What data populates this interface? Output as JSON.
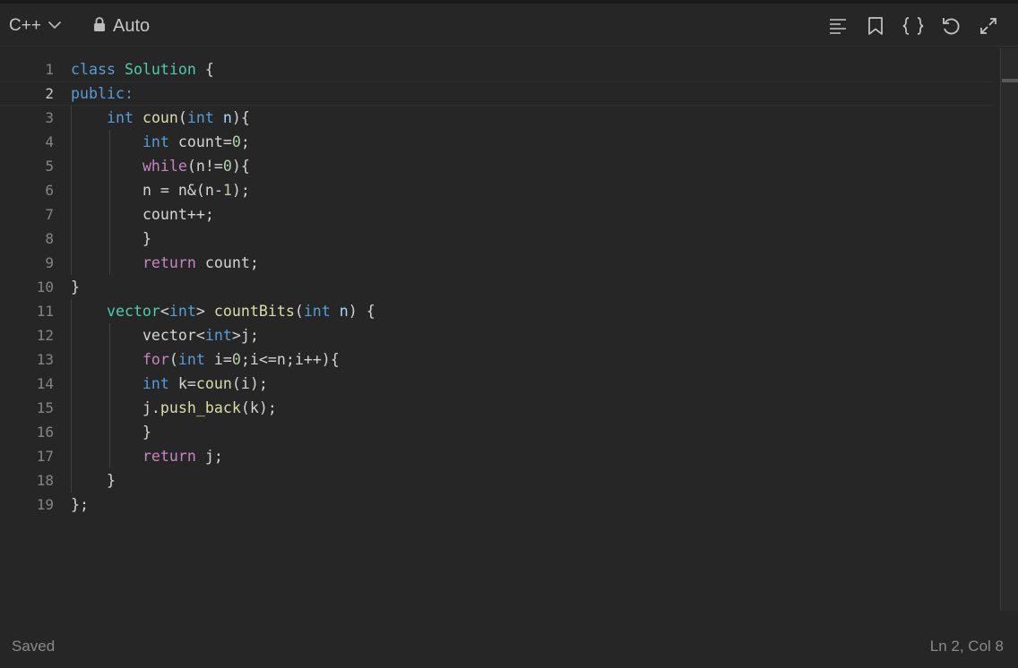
{
  "toolbar": {
    "language": "C++",
    "mode": "Auto",
    "icons": [
      "format-icon",
      "bookmark-icon",
      "braces-icon",
      "undo-icon",
      "expand-icon"
    ]
  },
  "colors": {
    "background": "#262626",
    "keyword": "#569cd6",
    "type_name": "#4ec9b0",
    "function": "#dcdcaa",
    "control": "#c586c0",
    "number": "#b5cea8",
    "variable": "#9cdcfe",
    "plain": "#d4d4d4",
    "line_number": "#858585"
  },
  "editor": {
    "active_line": 2,
    "lines": [
      {
        "n": "1",
        "tokens": [
          {
            "t": "class",
            "c": "keyword"
          },
          {
            "t": " "
          },
          {
            "t": "Solution",
            "c": "type_name"
          },
          {
            "t": " {"
          }
        ]
      },
      {
        "n": "2",
        "tokens": [
          {
            "t": "public:",
            "c": "keyword"
          }
        ]
      },
      {
        "n": "3",
        "tokens": [
          {
            "t": "    "
          },
          {
            "t": "int",
            "c": "keyword"
          },
          {
            "t": " "
          },
          {
            "t": "coun",
            "c": "function"
          },
          {
            "t": "("
          },
          {
            "t": "int",
            "c": "keyword"
          },
          {
            "t": " "
          },
          {
            "t": "n",
            "c": "variable"
          },
          {
            "t": "){"
          }
        ]
      },
      {
        "n": "4",
        "tokens": [
          {
            "t": "        "
          },
          {
            "t": "int",
            "c": "keyword"
          },
          {
            "t": " count="
          },
          {
            "t": "0",
            "c": "number"
          },
          {
            "t": ";"
          }
        ]
      },
      {
        "n": "5",
        "tokens": [
          {
            "t": "        "
          },
          {
            "t": "while",
            "c": "control"
          },
          {
            "t": "(n!="
          },
          {
            "t": "0",
            "c": "number"
          },
          {
            "t": "){"
          }
        ]
      },
      {
        "n": "6",
        "tokens": [
          {
            "t": "        "
          },
          {
            "t": "n = n&(n-"
          },
          {
            "t": "1",
            "c": "number"
          },
          {
            "t": ");"
          }
        ]
      },
      {
        "n": "7",
        "tokens": [
          {
            "t": "        "
          },
          {
            "t": "count++;"
          }
        ]
      },
      {
        "n": "8",
        "tokens": [
          {
            "t": "        "
          },
          {
            "t": "}"
          }
        ]
      },
      {
        "n": "9",
        "tokens": [
          {
            "t": "        "
          },
          {
            "t": "return",
            "c": "control"
          },
          {
            "t": " count;"
          }
        ]
      },
      {
        "n": "10",
        "tokens": [
          {
            "t": "}"
          }
        ]
      },
      {
        "n": "11",
        "tokens": [
          {
            "t": "    "
          },
          {
            "t": "vector",
            "c": "type_name"
          },
          {
            "t": "<"
          },
          {
            "t": "int",
            "c": "keyword"
          },
          {
            "t": "> "
          },
          {
            "t": "countBits",
            "c": "function"
          },
          {
            "t": "("
          },
          {
            "t": "int",
            "c": "keyword"
          },
          {
            "t": " "
          },
          {
            "t": "n",
            "c": "variable"
          },
          {
            "t": ") {"
          }
        ]
      },
      {
        "n": "12",
        "tokens": [
          {
            "t": "        "
          },
          {
            "t": "vector<"
          },
          {
            "t": "int",
            "c": "keyword"
          },
          {
            "t": ">j;"
          }
        ]
      },
      {
        "n": "13",
        "tokens": [
          {
            "t": "        "
          },
          {
            "t": "for",
            "c": "control"
          },
          {
            "t": "("
          },
          {
            "t": "int",
            "c": "keyword"
          },
          {
            "t": " i="
          },
          {
            "t": "0",
            "c": "number"
          },
          {
            "t": ";i<=n;i++){"
          }
        ]
      },
      {
        "n": "14",
        "tokens": [
          {
            "t": "        "
          },
          {
            "t": "int",
            "c": "keyword"
          },
          {
            "t": " k="
          },
          {
            "t": "coun",
            "c": "function"
          },
          {
            "t": "(i);"
          }
        ]
      },
      {
        "n": "15",
        "tokens": [
          {
            "t": "        "
          },
          {
            "t": "j."
          },
          {
            "t": "push_back",
            "c": "function"
          },
          {
            "t": "(k);"
          }
        ]
      },
      {
        "n": "16",
        "tokens": [
          {
            "t": "        "
          },
          {
            "t": "}"
          }
        ]
      },
      {
        "n": "17",
        "tokens": [
          {
            "t": "        "
          },
          {
            "t": "return",
            "c": "control"
          },
          {
            "t": " j;"
          }
        ]
      },
      {
        "n": "18",
        "tokens": [
          {
            "t": "    "
          },
          {
            "t": "}"
          }
        ]
      },
      {
        "n": "19",
        "tokens": [
          {
            "t": "};"
          }
        ]
      }
    ]
  },
  "status": {
    "left": "Saved",
    "right": "Ln 2, Col 8"
  }
}
